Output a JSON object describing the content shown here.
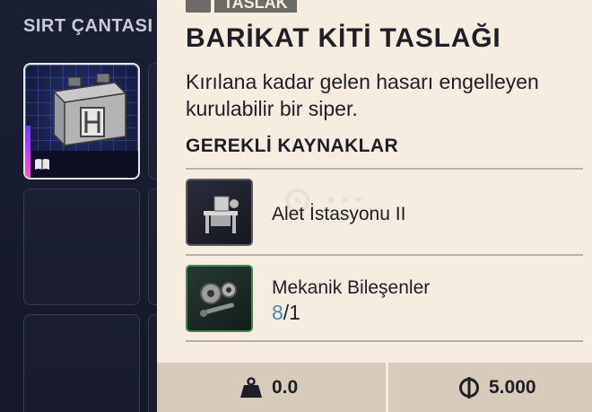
{
  "backpack": {
    "title": "SIRT ÇANTASI"
  },
  "item": {
    "category": "TASLAK",
    "title": "BARİKAT KİTİ TASLAĞI",
    "description": "Kırılana kadar gelen hasarı engelleyen kurulabilir bir siper.",
    "requirements_title": "GEREKLİ KAYNAKLAR",
    "requirements": [
      {
        "name": "Alet İstasyonu II",
        "icon": "workbench-icon"
      },
      {
        "name": "Mekanik Bileşenler",
        "icon": "gears-icon",
        "have": "8",
        "need": "/1"
      }
    ]
  },
  "footer": {
    "weight": "0.0",
    "weight_icon": "weight-icon",
    "value": "5.000",
    "value_icon": "coin-icon"
  },
  "colors": {
    "panel_bg": "#f7ece0",
    "footer_bg": "#d9cbbb",
    "have_count": "#4c87b5",
    "rarity": "#c43cff"
  }
}
